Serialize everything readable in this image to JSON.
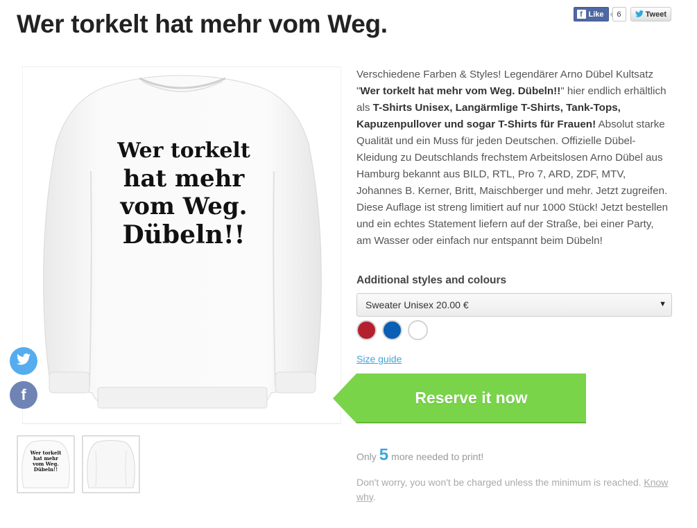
{
  "product": {
    "title": "Wer torkelt hat mehr vom Weg.",
    "shirt_print_lines": [
      "Wer torkelt",
      "hat mehr",
      "vom Weg.",
      "Dübeln!!"
    ]
  },
  "social_top": {
    "like_label": "Like",
    "like_count": "6",
    "tweet_label": "Tweet"
  },
  "description": {
    "t1": "Verschiedene Farben & Styles! Legendärer Arno Dübel Kultsatz \"",
    "b1": "Wer torkelt hat mehr vom Weg. Dübeln!!",
    "t2": "\" hier endlich erhältlich als ",
    "b2": "T-Shirts Unisex, Langärmlige T-Shirts, Tank-Tops, Kapuzenpullover und sogar T-Shirts für Frauen!",
    "t3": " Absolut starke Qualität und ein Muss für jeden Deutschen. Offizielle Dübel-Kleidung zu Deutschlands frechstem Arbeitslosen Arno Dübel aus Hamburg bekannt aus BILD, RTL, Pro 7, ARD, ZDF, MTV, Johannes B. Kerner, Britt, Maischberger und mehr. Jetzt zugreifen. Diese Auflage ist streng limitiert auf nur 1000 Stück! Jetzt bestellen und ein echtes Statement liefern auf der Straße, bei einer Party, am Wasser oder einfach nur entspannt beim Dübeln!"
  },
  "styles": {
    "label": "Additional styles and colours",
    "selected": "Sweater Unisex 20.00 €",
    "colors": [
      "#b5202e",
      "#0a5fb4",
      "#ffffff"
    ]
  },
  "size_guide": "Size guide",
  "reserve_button": "Reserve it now",
  "campaign": {
    "needed_prefix": "Only",
    "needed_count": "5",
    "needed_suffix": "more needed to print!",
    "worry_text": "Don't worry, you won't be charged unless the minimum is reached. ",
    "know_why": "Know why",
    "period": "."
  },
  "icons": {
    "twitter": "twitter-icon",
    "facebook": "facebook-icon"
  }
}
